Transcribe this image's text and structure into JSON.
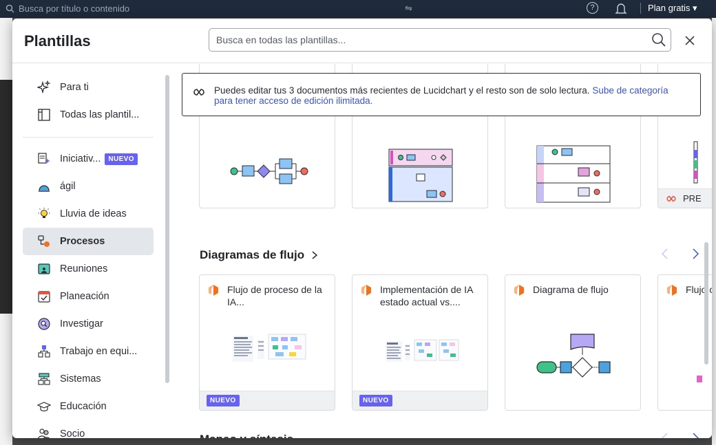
{
  "topbar": {
    "search_placeholder": "Busca por título o contenido",
    "help_label": "?",
    "plan_label": "Plan gratis ▾"
  },
  "modal": {
    "title": "Plantillas",
    "search_placeholder": "Busca en todas las plantillas...",
    "close_label": "×"
  },
  "sidebar": {
    "top_items": [
      {
        "label": "Para ti",
        "icon": "sparkle-icon"
      },
      {
        "label": "Todas las plantil...",
        "icon": "layout-icon"
      }
    ],
    "items": [
      {
        "label": "Iniciativ...",
        "icon": "ai-initiative-icon",
        "badge": "NUEVO"
      },
      {
        "label": "ágil",
        "icon": "agile-icon"
      },
      {
        "label": "Lluvia de ideas",
        "icon": "lightbulb-icon"
      },
      {
        "label": "Procesos",
        "icon": "process-icon",
        "active": true
      },
      {
        "label": "Reuniones",
        "icon": "meeting-icon"
      },
      {
        "label": "Planeación",
        "icon": "calendar-check-icon"
      },
      {
        "label": "Investigar",
        "icon": "research-icon"
      },
      {
        "label": "Trabajo en equi...",
        "icon": "team-icon"
      },
      {
        "label": "Sistemas",
        "icon": "systems-icon"
      },
      {
        "label": "Educación",
        "icon": "graduation-cap-icon"
      },
      {
        "label": "Socio",
        "icon": "partner-icon"
      }
    ]
  },
  "banner": {
    "text": "Puedes editar tus 3 documentos más recientes de Lucidchart y el resto son de solo lectura. ",
    "link": "Sube de categoría para tener acceso de edición ilimitada."
  },
  "top_row": {
    "premium_label": "PRE"
  },
  "sections": [
    {
      "title": "Diagramas de flujo",
      "cards": [
        {
          "title": "Flujo de proceso de la IA...",
          "badge": "NUEVO"
        },
        {
          "title": "Implementación de IA estado actual vs....",
          "badge": "NUEVO"
        },
        {
          "title": "Diagrama de flujo",
          "badge": ""
        },
        {
          "title": "Flujo cue",
          "badge": ""
        }
      ]
    },
    {
      "title": "Mapeo y síntesis",
      "cards": []
    }
  ],
  "colors": {
    "accent": "#6663f4",
    "link": "#3c53c9",
    "lucid_orange": "#f2711c",
    "active_bg": "#e3e6ea"
  }
}
